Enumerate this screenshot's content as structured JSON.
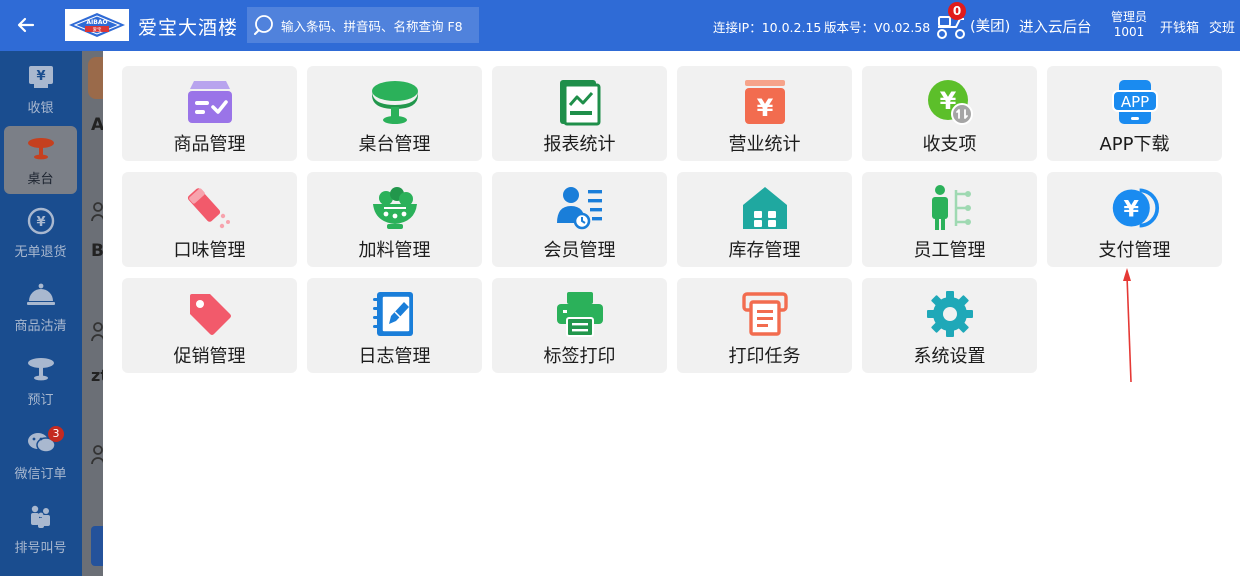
{
  "header": {
    "brand_name": "爱宝大酒楼",
    "logo_text_top": "AIBAO",
    "logo_text_bottom": "爱宝",
    "search_placeholder": "输入条码、拼音码、名称查询 F8",
    "connection": "连接IP：10.0.2.15",
    "version": "版本号：V0.02.58",
    "meituan_badge": "0",
    "meituan_label": "(美团)",
    "cloud_link": "进入云后台",
    "user_role": "管理员",
    "user_id": "1001",
    "cash_box": "开钱箱",
    "shift": "交班"
  },
  "rail": {
    "items": [
      {
        "label": "收银",
        "icon": "cashier-icon"
      },
      {
        "label": "桌台",
        "icon": "table-icon"
      },
      {
        "label": "无单退货",
        "icon": "refund-icon"
      },
      {
        "label": "商品沽清",
        "icon": "cloche-icon"
      },
      {
        "label": "预订",
        "icon": "reserve-icon"
      },
      {
        "label": "微信订单",
        "icon": "wechat-icon",
        "badge": "3"
      },
      {
        "label": "排号叫号",
        "icon": "queue-icon"
      }
    ]
  },
  "background_fragments": [
    "A",
    "B",
    "zt"
  ],
  "menu": {
    "tiles": [
      {
        "label": "商品管理",
        "icon": "product-management-icon"
      },
      {
        "label": "桌台管理",
        "icon": "table-management-icon"
      },
      {
        "label": "报表统计",
        "icon": "report-icon"
      },
      {
        "label": "营业统计",
        "icon": "business-stats-icon"
      },
      {
        "label": "收支项",
        "icon": "income-expense-icon"
      },
      {
        "label": "APP下载",
        "icon": "app-download-icon"
      },
      {
        "label": "口味管理",
        "icon": "flavor-icon"
      },
      {
        "label": "加料管理",
        "icon": "topping-icon"
      },
      {
        "label": "会员管理",
        "icon": "member-icon"
      },
      {
        "label": "库存管理",
        "icon": "inventory-icon"
      },
      {
        "label": "员工管理",
        "icon": "staff-icon"
      },
      {
        "label": "支付管理",
        "icon": "payment-icon"
      },
      {
        "label": "促销管理",
        "icon": "promotion-icon"
      },
      {
        "label": "日志管理",
        "icon": "log-icon"
      },
      {
        "label": "标签打印",
        "icon": "label-print-icon"
      },
      {
        "label": "打印任务",
        "icon": "print-task-icon"
      },
      {
        "label": "系统设置",
        "icon": "settings-icon"
      }
    ]
  },
  "colors": {
    "header": "#2f6bd6",
    "rail": "#1a4d8f",
    "tile_bg": "#f1f1f1",
    "annotation_arrow": "#e53935"
  }
}
